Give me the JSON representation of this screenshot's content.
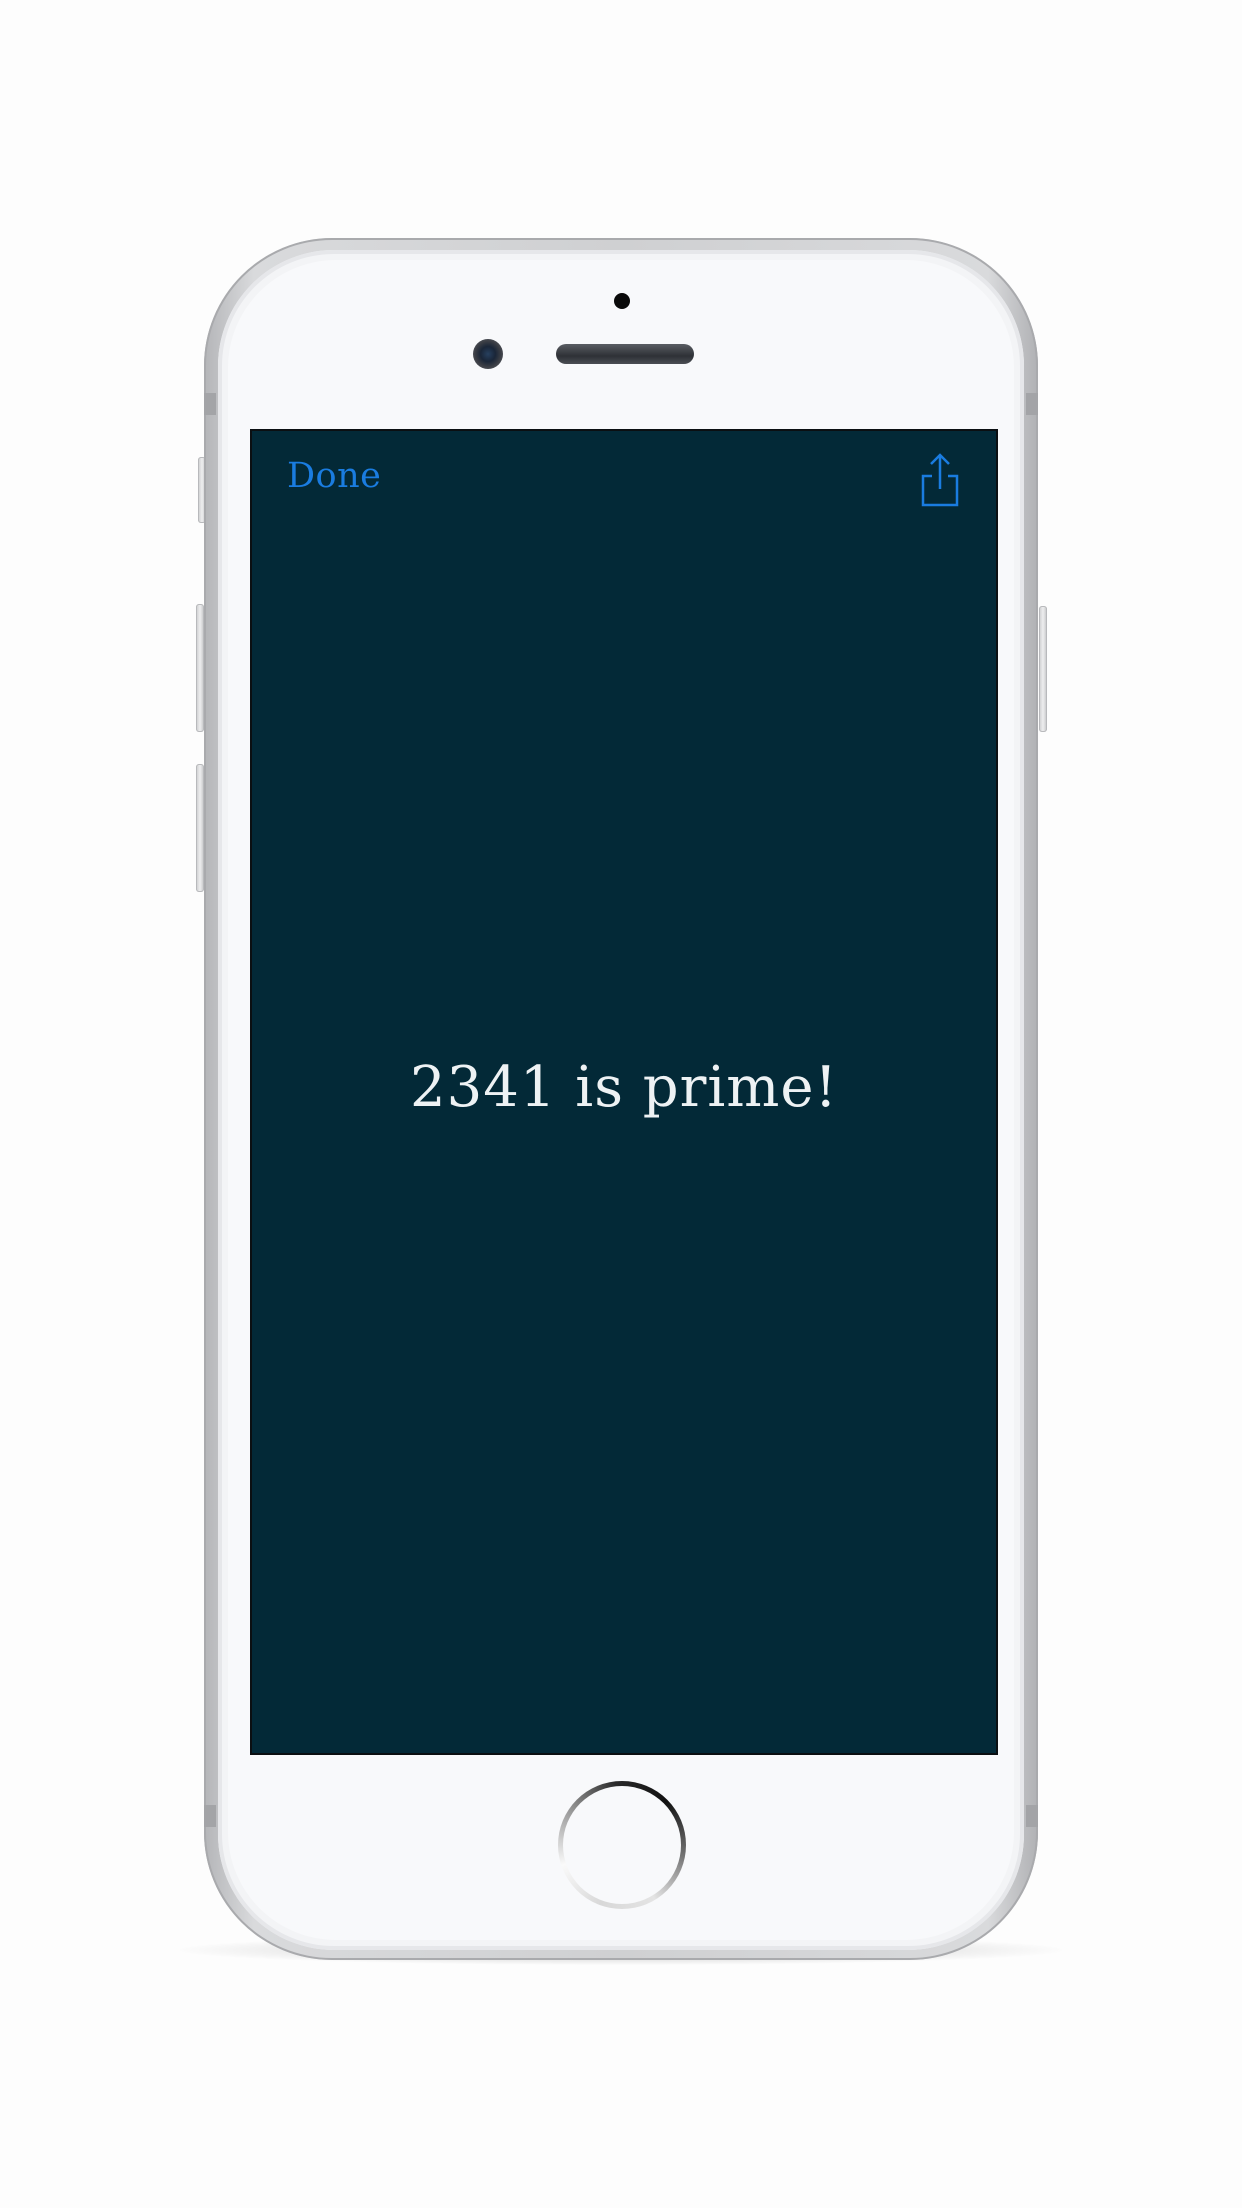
{
  "device": {
    "model": "iPhone",
    "color": "silver",
    "bezel_color": "#f8f9fb",
    "frame_color": "#cfd0d2"
  },
  "screen": {
    "background_color": "#032937",
    "nav": {
      "done_label": "Done",
      "done_color": "#1a7ce0",
      "share_icon": "share-icon"
    },
    "result": {
      "message": "2341 is prime!",
      "text_color": "#eef2f4"
    }
  }
}
